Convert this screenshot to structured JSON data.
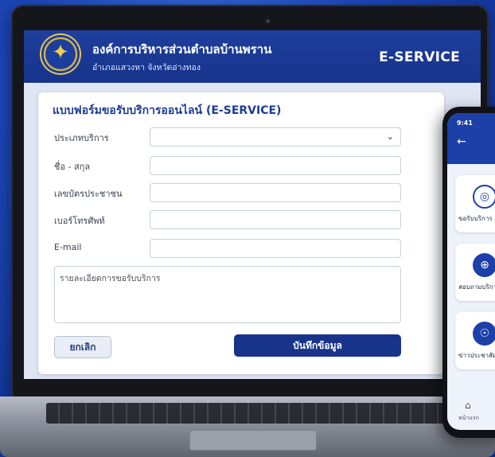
{
  "header": {
    "org_name": "องค์การบริหารส่วนตำบลบ้านพราน",
    "org_sub": "อำเภอแสวงหา จังหวัดอ่างทอง",
    "badge": "E-SERVICE"
  },
  "form": {
    "title": "แบบฟอร์มขอรับบริการออนไลน์ (E-SERVICE)",
    "fields": [
      {
        "label": "ประเภทบริการ",
        "value": "",
        "type": "select"
      },
      {
        "label": "ชื่อ - สกุล",
        "value": ""
      },
      {
        "label": "เลขบัตรประชาชน",
        "value": ""
      },
      {
        "label": "เบอร์โทรศัพท์",
        "value": ""
      },
      {
        "label": "E-mail",
        "value": ""
      }
    ],
    "details_placeholder": "รายละเอียดการขอรับบริการ",
    "cancel_label": "ยกเลิก",
    "save_label": "บันทึกข้อมูล"
  },
  "phone": {
    "time": "9:41",
    "tiles": [
      {
        "label": "ขอรับบริการ",
        "icon": "service-icon"
      },
      {
        "label": "สอบถามบริการ",
        "icon": "info-icon"
      },
      {
        "label": "ข่าวประชาสัมพันธ์",
        "icon": "news-icon"
      }
    ],
    "nav_label": "หน้าแรก"
  },
  "colors": {
    "brand": "#17338a",
    "background": "#1c46b8"
  }
}
